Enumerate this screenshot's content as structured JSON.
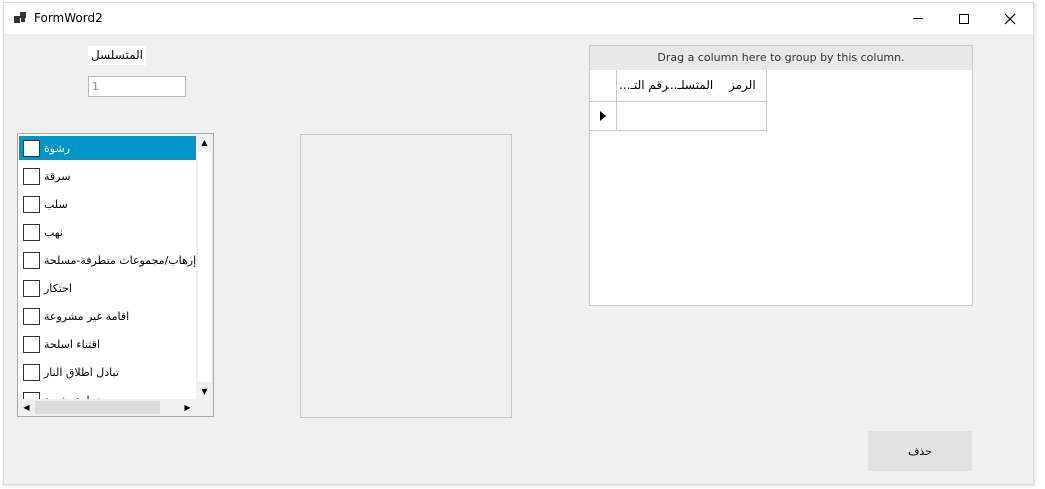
{
  "window": {
    "title": "FormWord2",
    "icon": "app-form-icon",
    "controls": [
      "minimize-icon",
      "maximize-icon",
      "close-icon"
    ]
  },
  "sequence": {
    "label": "المتسلسل",
    "value": "1"
  },
  "checklist": {
    "items": [
      {
        "label": "رشوة",
        "checked": false,
        "selected": true
      },
      {
        "label": "سرقة",
        "checked": false,
        "selected": false
      },
      {
        "label": "سلب",
        "checked": false,
        "selected": false
      },
      {
        "label": "نهب",
        "checked": false,
        "selected": false
      },
      {
        "label": "إرهاب/مجموعات متطرفة-مسلحة",
        "checked": false,
        "selected": false
      },
      {
        "label": "احتكار",
        "checked": false,
        "selected": false
      },
      {
        "label": "اقامة غير مشروعة",
        "checked": false,
        "selected": false
      },
      {
        "label": "اقتناء اسلحة",
        "checked": false,
        "selected": false
      },
      {
        "label": "تبادل اطلاق النار",
        "checked": false,
        "selected": false
      },
      {
        "label": "تجارة بشرية",
        "checked": false,
        "selected": false
      }
    ],
    "selected_color": "#0096c7"
  },
  "grid": {
    "group_panel_text": "Drag a column here to group by this column.",
    "columns": [
      "الرمز",
      "المتسلـ...",
      "رقم التـ..."
    ],
    "new_row_indicator": "row-pointer-icon"
  },
  "actions": {
    "delete_label": "حذف"
  }
}
